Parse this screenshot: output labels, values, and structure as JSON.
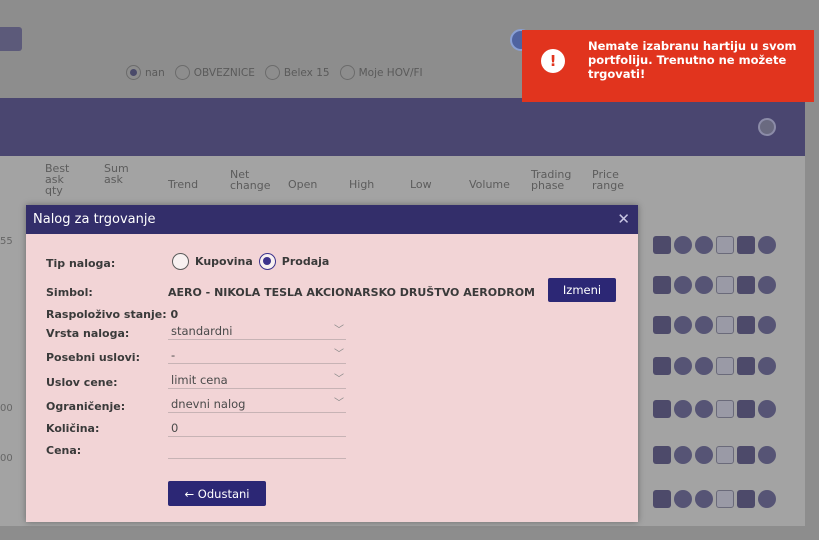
{
  "background": {
    "radio_options": [
      {
        "label": "nan",
        "selected": true
      },
      {
        "label": "OBVEZNICE",
        "selected": false
      },
      {
        "label": "Belex 15",
        "selected": false
      },
      {
        "label": "Moje HOV/FI",
        "selected": false
      }
    ],
    "columns": [
      {
        "label": "Best ask qty"
      },
      {
        "label": "Sum ask"
      },
      {
        "label": "Trend"
      },
      {
        "label": "Net change"
      },
      {
        "label": "Open"
      },
      {
        "label": "High"
      },
      {
        "label": "Low"
      },
      {
        "label": "Volume"
      },
      {
        "label": "Trading phase"
      },
      {
        "label": "Price range"
      }
    ],
    "left_edge_values": [
      "55",
      "00",
      "00"
    ],
    "row_icon_names": [
      "calendar-icon",
      "globe-icon",
      "cancel-icon",
      "chart-icon",
      "trade-icon",
      "pie-chart-icon"
    ]
  },
  "toast": {
    "message": "Nemate izabranu hartiju u svom portfoliju. Trenutno ne možete trgovati!",
    "icon": "exclamation-icon",
    "color": "#e1341e"
  },
  "modal": {
    "title": "Nalog za trgovanje",
    "close_icon": "close-icon",
    "order_type_label": "Tip naloga:",
    "order_type_options": [
      {
        "label": "Kupovina",
        "selected": false
      },
      {
        "label": "Prodaja",
        "selected": true
      }
    ],
    "symbol_label": "Simbol:",
    "symbol_value": "AERO - NIKOLA TESLA AKCIONARSKO DRUŠTVO AERODROM",
    "change_button": "Izmeni",
    "available_balance_label": "Raspoloživo stanje: 0",
    "order_kind_label": "Vrsta naloga:",
    "order_kind_value": "standardni",
    "special_conditions_label": "Posebni uslovi:",
    "special_conditions_value": "-",
    "price_condition_label": "Uslov cene:",
    "price_condition_value": "limit cena",
    "restriction_label": "Ograničenje:",
    "restriction_value": "dnevni nalog",
    "quantity_label": "Količina:",
    "quantity_value": "0",
    "price_label": "Cena:",
    "price_value": "",
    "cancel_button": "← Odustani"
  },
  "colors": {
    "accent": "#2c2775",
    "modal_header": "#332e6a",
    "modal_body": "#f2d4d6",
    "error": "#e1341e"
  }
}
